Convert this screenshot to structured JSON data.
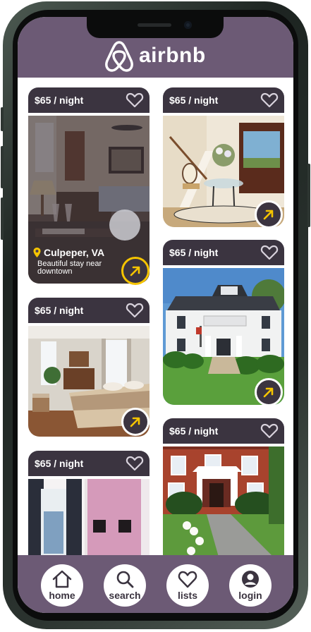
{
  "app": {
    "brand": "airbnb",
    "colors": {
      "header": "#6c5a75",
      "card_dark": "#3b3440",
      "highlight_ring": "#f5c400",
      "arrow": "#f5c400"
    }
  },
  "listings": [
    {
      "price": "$65 / night",
      "arrow_icon": "arrow-up-right-icon",
      "heart_icon": "heart-outline-icon",
      "location": "Culpeper, VA",
      "description": "Beautiful stay near downtown",
      "selected": true
    },
    {
      "price": "$65 / night",
      "arrow_icon": "arrow-up-right-icon",
      "heart_icon": "heart-outline-icon"
    },
    {
      "price": "$65 / night",
      "arrow_icon": "arrow-up-right-icon",
      "heart_icon": "heart-outline-icon"
    },
    {
      "price": "$65 / night",
      "arrow_icon": "arrow-up-right-icon",
      "heart_icon": "heart-outline-icon"
    },
    {
      "price": "$65 / night",
      "heart_icon": "heart-outline-icon"
    },
    {
      "price": "$65 / night",
      "heart_icon": "heart-outline-icon"
    }
  ],
  "nav": [
    {
      "label": "home",
      "icon": "home-icon"
    },
    {
      "label": "search",
      "icon": "search-icon"
    },
    {
      "label": "lists",
      "icon": "heart-icon"
    },
    {
      "label": "login",
      "icon": "user-icon"
    }
  ]
}
